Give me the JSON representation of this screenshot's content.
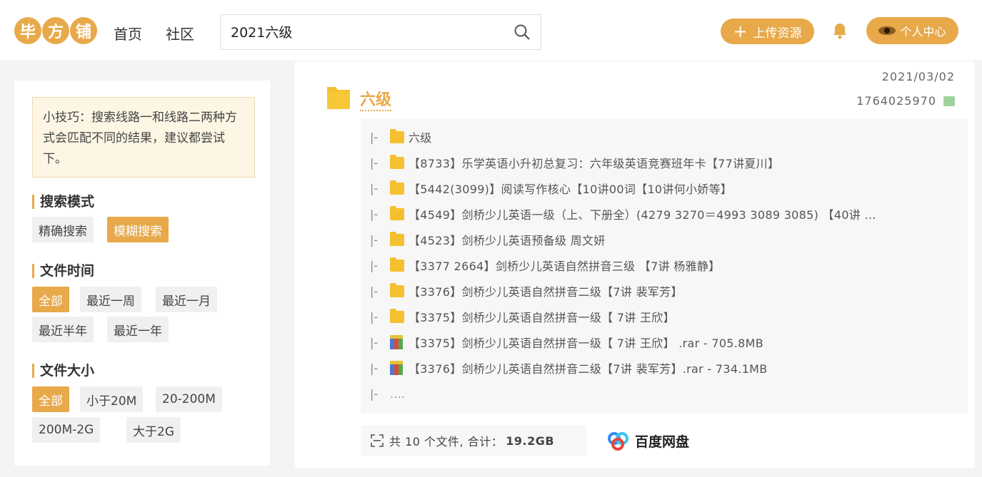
{
  "header": {
    "logo_chars": [
      "毕",
      "方",
      "铺"
    ],
    "nav": [
      "首页",
      "社区"
    ],
    "search_value": "2021六级",
    "upload_label": "上传资源",
    "user_label": "个人中心"
  },
  "sidebar": {
    "tip": "小技巧：搜索线路一和线路二两种方式会匹配不同的结果，建议都尝试下。",
    "search_mode": {
      "title": "搜索模式",
      "options": [
        "精确搜索",
        "模糊搜索"
      ],
      "active": "模糊搜索"
    },
    "file_time": {
      "title": "文件时间",
      "options": [
        "全部",
        "最近一周",
        "最近一月",
        "最近半年",
        "最近一年"
      ],
      "active": "全部"
    },
    "file_size": {
      "title": "文件大小",
      "options": [
        "全部",
        "小于20M",
        "20-200M",
        "200M-2G",
        "大于2G"
      ],
      "active": "全部"
    }
  },
  "result": {
    "title": "六级",
    "date": "2021/03/02",
    "sharer": "1764025970",
    "tree": [
      {
        "type": "folder",
        "name": "六级"
      },
      {
        "type": "folder",
        "name": "【8733】乐学英语小升初总复习：六年级英语竞赛班年卡【77讲夏川】"
      },
      {
        "type": "folder",
        "name": "【5442(3099)】阅读写作核心【10讲00词【10讲何小娇等】"
      },
      {
        "type": "folder",
        "name": "【4549】剑桥少儿英语一级（上、下册全）(4279 3270＝4993 3089 3085) 【40讲 ..."
      },
      {
        "type": "folder",
        "name": "【4523】剑桥少儿英语预备级 周文妍"
      },
      {
        "type": "folder",
        "name": "【3377 2664】剑桥少儿英语自然拼音三级 【7讲 杨雅静】"
      },
      {
        "type": "folder",
        "name": "【3376】剑桥少儿英语自然拼音二级【7讲 裴军芳】"
      },
      {
        "type": "folder",
        "name": "【3375】剑桥少儿英语自然拼音一级【 7讲 王欣】"
      },
      {
        "type": "rar",
        "name": "【3375】剑桥少儿英语自然拼音一级【 7讲 王欣】 .rar - 705.8MB"
      },
      {
        "type": "rar",
        "name": "【3376】剑桥少儿英语自然拼音二级【7讲 裴军芳】.rar - 734.1MB"
      },
      {
        "type": "more",
        "name": "...."
      }
    ],
    "pipe": "|-",
    "summary_prefix": "共 10 个文件, 合计：",
    "summary_size": "19.2GB",
    "provider": "百度网盘"
  },
  "colors": {
    "accent": "#e8a94a",
    "folder": "#f5c02f"
  }
}
